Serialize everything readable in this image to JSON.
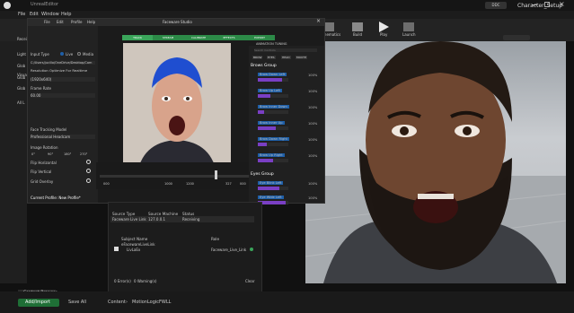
{
  "editor": {
    "title_tab": "UnrealEditor",
    "project": "Character_Setup",
    "menu": [
      "File",
      "Edit",
      "Window",
      "Help"
    ],
    "toolbar": [
      {
        "label": "Cinematics"
      },
      {
        "label": "Build"
      },
      {
        "label": "Play"
      },
      {
        "label": "Launch"
      }
    ],
    "left_items": [
      "Recei",
      "Light",
      "Glob",
      "Glob",
      "Visual",
      "Glob",
      "All L"
    ],
    "content_browser_tab": "Content Browser",
    "add_import": "Add/Import",
    "save_all": "Save All",
    "breadcrumb": [
      "Content",
      "MotionLogicFWLL"
    ],
    "colors": {
      "accent": "#1e5fa8",
      "green": "#3aa55a"
    }
  },
  "face_tracker": {
    "window_title": "Faceware Studio",
    "nav_tabs": [
      "TRACK",
      "STREAM",
      "CALIBRATE",
      "EFFECTS",
      "EXPORT"
    ],
    "left": {
      "tab_labels": [
        "File",
        "Edit",
        "Profile",
        "Help"
      ],
      "input_type_label": "Input Type",
      "input_type_value": "Live",
      "input_type_option2": "Media",
      "path": "C:/Users/jucillo/OneDrive/Desktop/Cam",
      "resolution_label": "Resolution Optimize For Realtime",
      "resolution_value": "(1920x640)",
      "frame_rate_label": "Frame Rate",
      "frame_rate_value": "60.00",
      "face_tracking_label": "Face Tracking Model",
      "face_tracking_value": "Professional Headcam",
      "image_rotation_label": "Image Rotation",
      "rotations": [
        "0°",
        "90°",
        "180°",
        "270°"
      ],
      "flip_horizontal": "Flip Horizontal",
      "flip_vertical": "Flip Vertical",
      "grid_overlay": "Grid Overlay",
      "current_profile": "Current Profile: New Profile*"
    },
    "timeline": {
      "start": "000",
      "mid1": "1000",
      "mid2": "1200",
      "end": "327",
      "end2": "000"
    },
    "animation_tuning": {
      "title": "ANIMATION TUNING",
      "search_placeholder": "Search Controls",
      "filters": [
        "BROW",
        "EYES",
        "HEAD",
        "MOUTH"
      ],
      "groups": [
        {
          "name": "Brows Group",
          "rows": [
            {
              "label": "Brow Down Left",
              "value": "100%",
              "level": 0.8
            },
            {
              "label": "Brow Up Left",
              "value": "100%",
              "level": 0.4
            },
            {
              "label": "Brow Inner Down",
              "value": "100%",
              "level": 0.2
            },
            {
              "label": "Brow Inner Up",
              "value": "100%",
              "level": 0.6
            },
            {
              "label": "Brow Down Right",
              "value": "100%",
              "level": 0.3
            },
            {
              "label": "Brow Up Right",
              "value": "100%",
              "level": 0.5
            }
          ]
        },
        {
          "name": "Eyes Group",
          "rows": [
            {
              "label": "Eye Blink Left",
              "value": "100%",
              "level": 0.7
            },
            {
              "label": "Eye Wide Left",
              "value": "100%",
              "level": 0.9
            }
          ]
        }
      ]
    }
  },
  "live_link": {
    "source_type_header": "Source Type",
    "source_machine_header": "Source Machine",
    "status_header": "Status",
    "source_type": "Faceware Live Link",
    "source_machine": "127.0.0.1",
    "status": "Receiving",
    "subject_name_header": "Subject Name",
    "role_header": "Role",
    "subject_group": "eFacewareLiveLink",
    "subject": "LivLaEx",
    "role": "Faceware_Live_Link",
    "errors": "0 Error(s)",
    "warnings": "0 Warning(s)",
    "clear": "Clear"
  }
}
